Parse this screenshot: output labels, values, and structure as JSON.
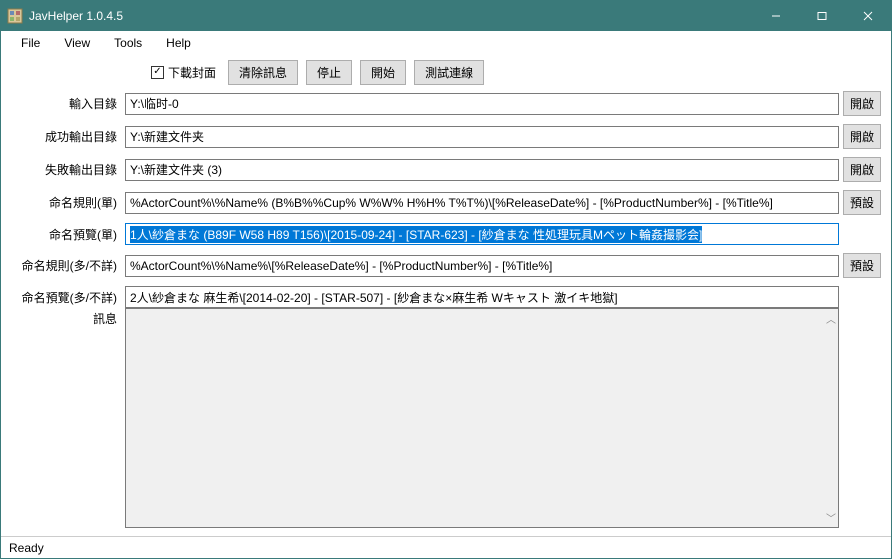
{
  "window": {
    "title": "JavHelper 1.0.4.5"
  },
  "menu": {
    "file": "File",
    "view": "View",
    "tools": "Tools",
    "help": "Help"
  },
  "toolbar": {
    "download_cover_label": "下載封面",
    "download_cover_checked": true,
    "clear_msg": "清除訊息",
    "stop": "停止",
    "start": "開始",
    "test_conn": "測試連線"
  },
  "rows": {
    "input_dir": {
      "label": "輸入目錄",
      "value": "Y:\\临时-0",
      "btn": "開啟"
    },
    "success_dir": {
      "label": "成功輸出目錄",
      "value": "Y:\\新建文件夹",
      "btn": "開啟"
    },
    "fail_dir": {
      "label": "失敗輸出目錄",
      "value": "Y:\\新建文件夹 (3)",
      "btn": "開啟"
    },
    "rule_single": {
      "label": "命名規則(單)",
      "value": "%ActorCount%\\%Name% (B%B%%Cup% W%W% H%H% T%T%)\\[%ReleaseDate%] - [%ProductNumber%] - [%Title%]",
      "btn": "預設"
    },
    "preview_single": {
      "label": "命名預覽(單)",
      "value": "1人\\紗倉まな (B89F W58 H89 T156)\\[2015-09-24] - [STAR-623] - [紗倉まな 性処理玩具Mペット輪姦撮影会]"
    },
    "rule_multi": {
      "label": "命名規則(多/不詳)",
      "value": "%ActorCount%\\%Name%\\[%ReleaseDate%] - [%ProductNumber%] - [%Title%]",
      "btn": "預設"
    },
    "preview_multi": {
      "label": "命名預覽(多/不詳)",
      "value": "2人\\紗倉まな 麻生希\\[2014-02-20] - [STAR-507] - [紗倉まな×麻生希 Wキャスト 激イキ地獄]"
    },
    "messages": {
      "label": "訊息"
    }
  },
  "status": {
    "text": "Ready"
  }
}
